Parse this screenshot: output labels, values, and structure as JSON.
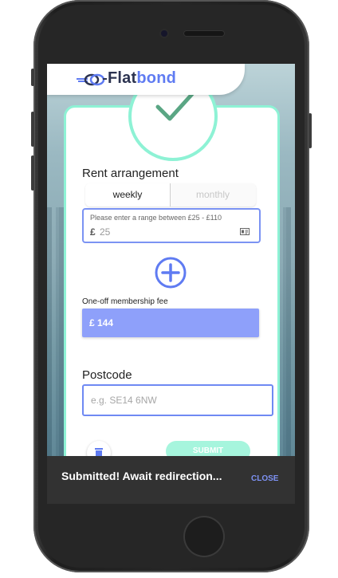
{
  "brand": {
    "name_part1": "Flat",
    "name_part2": "bond"
  },
  "rent": {
    "title": "Rent arrangement",
    "tabs": [
      {
        "label": "weekly",
        "selected": true
      },
      {
        "label": "monthly",
        "selected": false
      }
    ],
    "range_hint": "Please enter a range between £25 - £110",
    "currency_symbol": "£",
    "amount_placeholder": "25"
  },
  "fee": {
    "label": "One-off membership fee",
    "value_text": "£ 144"
  },
  "postcode": {
    "title": "Postcode",
    "placeholder": "e.g. SE14 6NW",
    "value": ""
  },
  "actions": {
    "submit_label": "SUBMIT"
  },
  "snackbar": {
    "message": "Submitted! Await redirection...",
    "action_label": "CLOSE"
  },
  "colors": {
    "accent": "#7b93f3",
    "mint": "#8ef2d5",
    "fee_bg": "#8ea0fa",
    "snackbar_bg": "#323232"
  },
  "icons": [
    "logo-knot-icon",
    "checkmark-icon",
    "id-card-icon",
    "plus-circle-icon",
    "trash-icon"
  ]
}
